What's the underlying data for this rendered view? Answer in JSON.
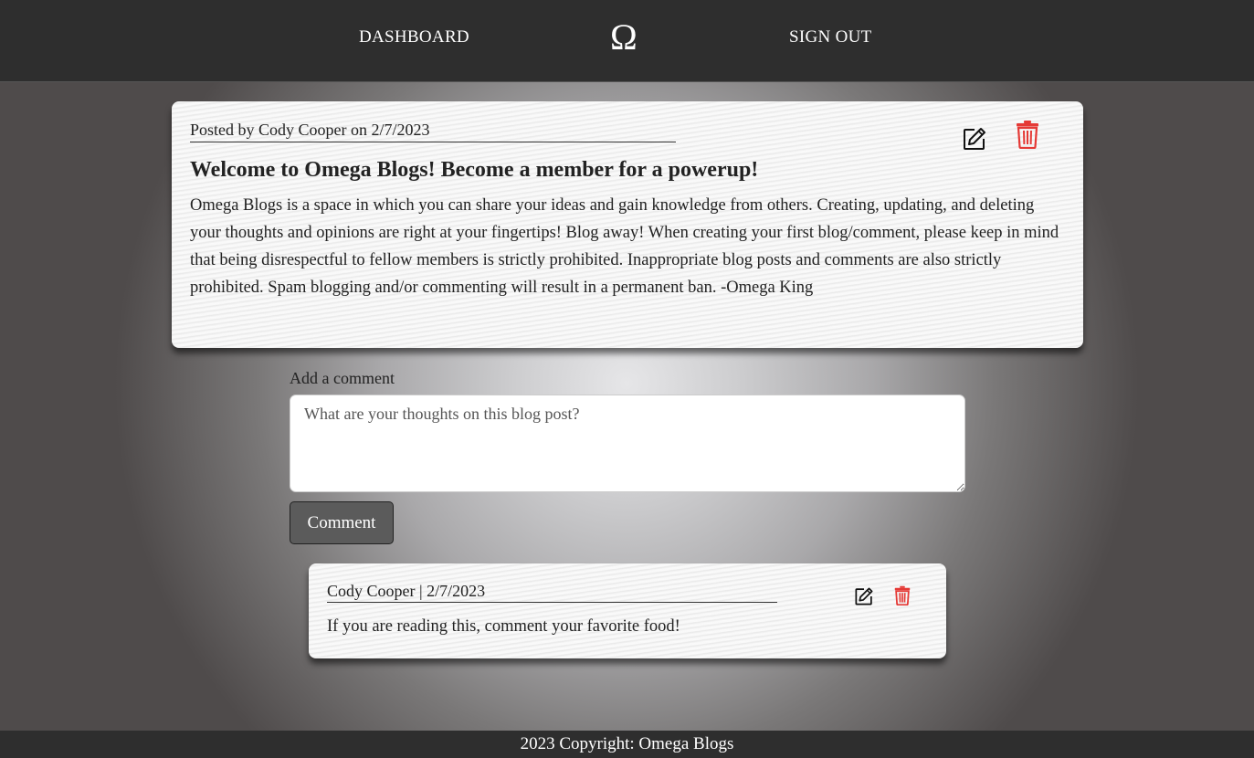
{
  "nav": {
    "dashboard_label": "DASHBOARD",
    "logo": "Ω",
    "signout_label": "SIGN OUT"
  },
  "post": {
    "meta": "Posted by Cody Cooper on 2/7/2023",
    "title": "Welcome to Omega Blogs! Become a member for a powerup!",
    "body": "Omega Blogs is a space in which you can share your ideas and gain knowledge from others. Creating, updating, and deleting your thoughts and opinions are right at your fingertips! Blog away! When creating your first blog/comment, please keep in mind that being disrespectful to fellow members is strictly prohibited. Inappropriate blog posts and comments are also strictly prohibited. Spam blogging and/or commenting will result in a permanent ban. -Omega King",
    "edit_icon": "edit-icon",
    "delete_icon": "trash-icon"
  },
  "comment_form": {
    "label": "Add a comment",
    "placeholder": "What are your thoughts on this blog post?",
    "value": "",
    "button_label": "Comment"
  },
  "comments": [
    {
      "meta": "Cody Cooper | 2/7/2023",
      "text": "If you are reading this, comment your favorite food!"
    }
  ],
  "footer": {
    "text": "2023 Copyright: Omega Blogs"
  },
  "colors": {
    "navbar": "#2e2e2e",
    "delete": "#e53935",
    "button": "#5b5b5b"
  }
}
